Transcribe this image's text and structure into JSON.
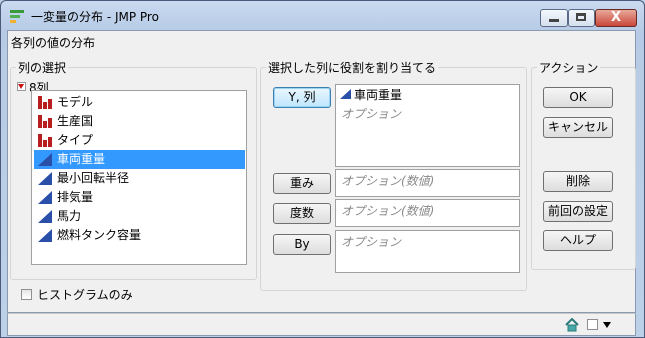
{
  "window": {
    "title": "一変量の分布 - JMP Pro",
    "close_glyph": "X"
  },
  "page_heading": "各列の値の分布",
  "columns_panel": {
    "legend": "列の選択",
    "count_label": "8列",
    "items": [
      {
        "label": "モデル",
        "type": "nominal",
        "selected": false
      },
      {
        "label": "生産国",
        "type": "nominal",
        "selected": false
      },
      {
        "label": "タイプ",
        "type": "nominal",
        "selected": false
      },
      {
        "label": "車両重量",
        "type": "continuous",
        "selected": true
      },
      {
        "label": "最小回転半径",
        "type": "continuous",
        "selected": false
      },
      {
        "label": "排気量",
        "type": "continuous",
        "selected": false
      },
      {
        "label": "馬力",
        "type": "continuous",
        "selected": false
      },
      {
        "label": "燃料タンク容量",
        "type": "continuous",
        "selected": false
      }
    ]
  },
  "roles_panel": {
    "legend": "選択した列に役割を割り当てる",
    "roles": [
      {
        "button": "Y, 列",
        "assigned": "車両重量",
        "placeholder": "オプション"
      },
      {
        "button": "重み",
        "placeholder": "オプション(数値)"
      },
      {
        "button": "度数",
        "placeholder": "オプション(数値)"
      },
      {
        "button": "By",
        "placeholder": "オプション"
      }
    ]
  },
  "actions_panel": {
    "legend": "アクション",
    "ok": "OK",
    "cancel": "キャンセル",
    "remove": "削除",
    "recall": "前回の設定",
    "help": "ヘルプ"
  },
  "histogram_only": {
    "label": "ヒストグラムのみ",
    "checked": false
  },
  "colors": {
    "selection": "#3399ff",
    "nominal_icon": "#b81e1e",
    "continuous_icon": "#2a4fa8"
  }
}
